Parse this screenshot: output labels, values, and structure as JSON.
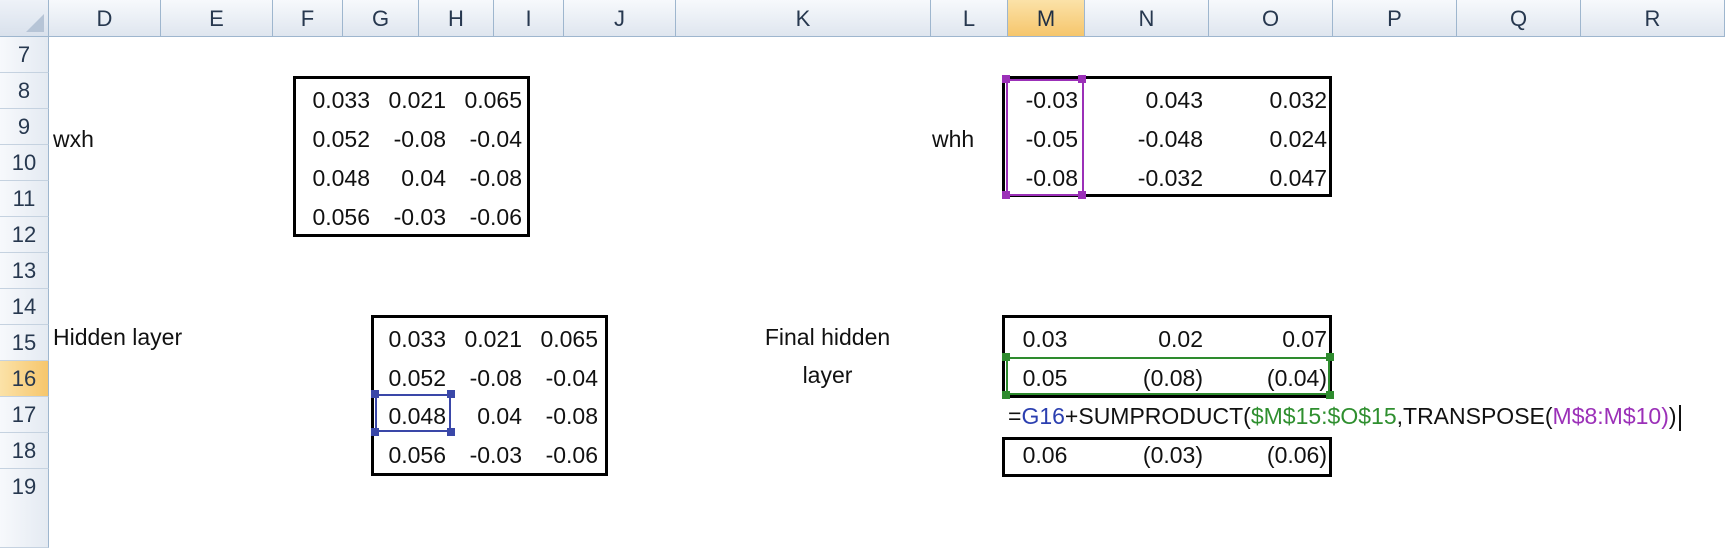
{
  "columns": [
    "D",
    "E",
    "F",
    "G",
    "H",
    "I",
    "J",
    "K",
    "L",
    "M",
    "N",
    "O",
    "P",
    "Q",
    "R"
  ],
  "rows": [
    "7",
    "8",
    "9",
    "10",
    "11",
    "12",
    "13",
    "14",
    "15",
    "16",
    "17",
    "18",
    "19"
  ],
  "labels": {
    "wxh": "wxh",
    "whh": "whh",
    "hidden_layer": "Hidden layer",
    "final_hidden_line1": "Final hidden",
    "final_hidden_line2": "layer"
  },
  "wxh": [
    [
      "0.033",
      "0.021",
      "0.065"
    ],
    [
      "0.052",
      "-0.08",
      "-0.04"
    ],
    [
      "0.048",
      "0.04",
      "-0.08"
    ],
    [
      "0.056",
      "-0.03",
      "-0.06"
    ]
  ],
  "whh": [
    [
      "-0.03",
      "0.043",
      "0.032"
    ],
    [
      "-0.05",
      "-0.048",
      "0.024"
    ],
    [
      "-0.08",
      "-0.032",
      "0.047"
    ]
  ],
  "hidden_layer": [
    [
      "0.033",
      "0.021",
      "0.065"
    ],
    [
      "0.052",
      "-0.08",
      "-0.04"
    ],
    [
      "0.048",
      "0.04",
      "-0.08"
    ],
    [
      "0.056",
      "-0.03",
      "-0.06"
    ]
  ],
  "final_hidden": {
    "row14": [
      "0.03",
      "0.02",
      "0.07"
    ],
    "row15": [
      "0.05",
      "(0.08)",
      "(0.04)"
    ],
    "row17": [
      "0.06",
      "(0.03)",
      "(0.06)"
    ]
  },
  "formula": {
    "eq": "=",
    "ref1": "G16",
    "plus_fn": "+SUMPRODUCT(",
    "ref2": "$M$15:$O$15",
    "comma_fn": ",TRANSPOSE(",
    "ref3": "M$8:M$10",
    "close_inner": ")",
    "close_outer": ")"
  },
  "colors": {
    "header_bg": "#dfe6ef",
    "header_selected": "#f6c66c",
    "ref_blue": "#2b3fb0",
    "ref_green": "#2f8f2f",
    "ref_purple": "#9b30b8"
  }
}
